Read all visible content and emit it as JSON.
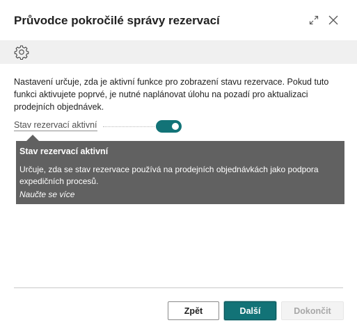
{
  "header": {
    "title": "Průvodce pokročilé správy rezervací"
  },
  "toolbar": {
    "settings_icon": "gear-icon"
  },
  "main": {
    "description": "Nastavení určuje, zda je aktivní funkce pro zobrazení stavu rezervace. Pokud tuto funkci aktivujete poprvé, je nutné naplánovat úlohu na pozadí pro aktualizaci prodejních objednávek.",
    "field": {
      "label": "Stav rezervací aktivní",
      "toggle_on": true
    },
    "tooltip": {
      "title": "Stav rezervací aktivní",
      "text": "Určuje, zda se stav rezervace používá na prodejních objednávkách jako podpora expedičních procesů.",
      "link": "Naučte se více"
    }
  },
  "footer": {
    "back_label": "Zpět",
    "next_label": "Další",
    "finish_label": "Dokončit"
  },
  "colors": {
    "accent": "#127377",
    "tooltip_bg": "#616161"
  }
}
